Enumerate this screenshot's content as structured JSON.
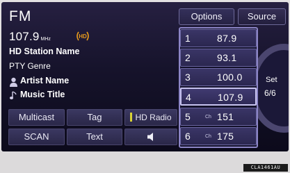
{
  "header": {
    "band": "FM",
    "frequency": "107.9",
    "frequency_unit": "MHz",
    "station_name": "HD Station Name",
    "pty_genre": "PTY Genre",
    "artist": "Artist Name",
    "title": "Music Title"
  },
  "top_buttons": {
    "options": "Options",
    "source": "Source"
  },
  "functions": {
    "multicast": "Multicast",
    "tag": "Tag",
    "hd_radio": "HD Radio",
    "scan": "SCAN",
    "text": "Text",
    "speaker_icon": "speaker-icon"
  },
  "presets": [
    {
      "number": "1",
      "channel_prefix": "",
      "value": "87.9"
    },
    {
      "number": "2",
      "channel_prefix": "",
      "value": "93.1"
    },
    {
      "number": "3",
      "channel_prefix": "",
      "value": "100.0"
    },
    {
      "number": "4",
      "channel_prefix": "",
      "value": "107.9"
    },
    {
      "number": "5",
      "channel_prefix": "Ch",
      "value": "151"
    },
    {
      "number": "6",
      "channel_prefix": "Ch",
      "value": "175"
    }
  ],
  "selected_preset": "4",
  "dial": {
    "label": "Set",
    "count": "6/6"
  },
  "figure_code": "CLA1461AU",
  "colors": {
    "screen_bg": "#16132b",
    "button_bg": "#2a2748",
    "preset_border": "#8c85c6",
    "hd_indicator": "#d9d335",
    "hd_signal": "#e89a1c"
  }
}
